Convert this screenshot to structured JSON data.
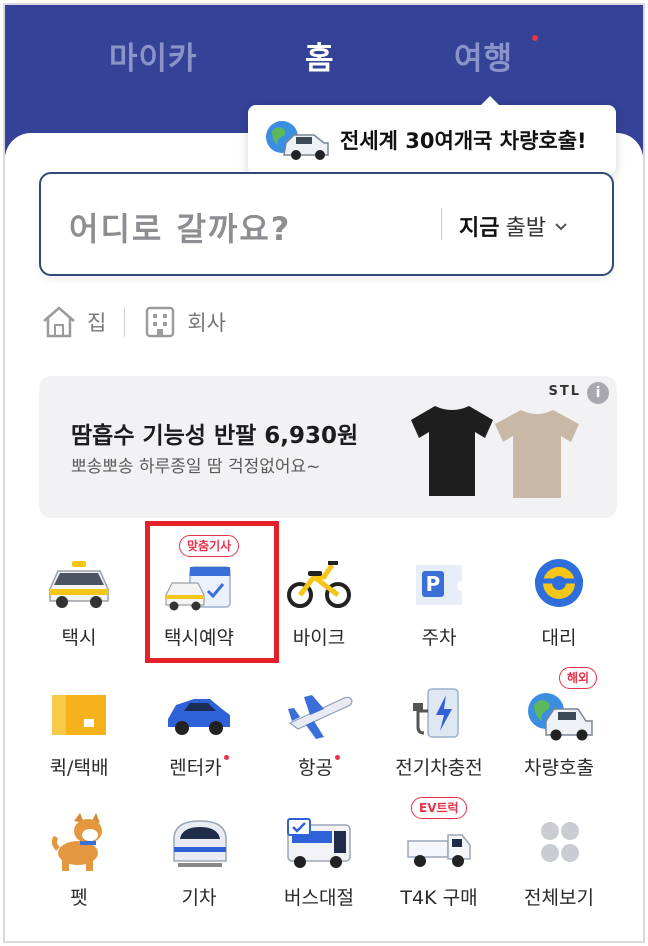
{
  "header": {
    "tabs": [
      {
        "label": "마이카",
        "active": false
      },
      {
        "label": "홈",
        "active": true
      },
      {
        "label": "여행",
        "active": false,
        "new_dot": true
      }
    ],
    "tooltip": "전세계 30여개국 차량호출!"
  },
  "search": {
    "placeholder": "어디로 갈까요?",
    "time_bold": "지금",
    "time_rest": "출발"
  },
  "shortcuts": [
    {
      "label": "집",
      "icon": "home-icon"
    },
    {
      "label": "회사",
      "icon": "building-icon"
    }
  ],
  "banner": {
    "title": "땀흡수 기능성 반팔 6,930원",
    "subtitle": "뽀송뽀송 하루종일 땀 걱정없어요~",
    "brand": "STL",
    "info": "i"
  },
  "services": [
    {
      "label": "택시",
      "icon": "taxi-icon"
    },
    {
      "label": "택시예약",
      "icon": "taxi-reservation-icon",
      "badge": "맞춤기사"
    },
    {
      "label": "바이크",
      "icon": "bike-icon"
    },
    {
      "label": "주차",
      "icon": "parking-icon"
    },
    {
      "label": "대리",
      "icon": "steering-wheel-icon"
    },
    {
      "label": "퀵/택배",
      "icon": "box-icon"
    },
    {
      "label": "렌터카",
      "icon": "rental-car-icon",
      "new_dot": true
    },
    {
      "label": "항공",
      "icon": "airplane-icon",
      "new_dot": true
    },
    {
      "label": "전기차충전",
      "icon": "ev-charger-icon"
    },
    {
      "label": "차량호출",
      "icon": "global-car-icon",
      "badge": "해외"
    },
    {
      "label": "펫",
      "icon": "dog-icon"
    },
    {
      "label": "기차",
      "icon": "train-icon"
    },
    {
      "label": "버스대절",
      "icon": "bus-icon"
    },
    {
      "label": "T4K 구매",
      "icon": "truck-icon",
      "badge": "EV트럭"
    },
    {
      "label": "전체보기",
      "icon": "all-menu-icon"
    }
  ],
  "colors": {
    "header_bg": "#344298",
    "accent_red": "#e9334b",
    "highlight_box": "#e32128"
  }
}
